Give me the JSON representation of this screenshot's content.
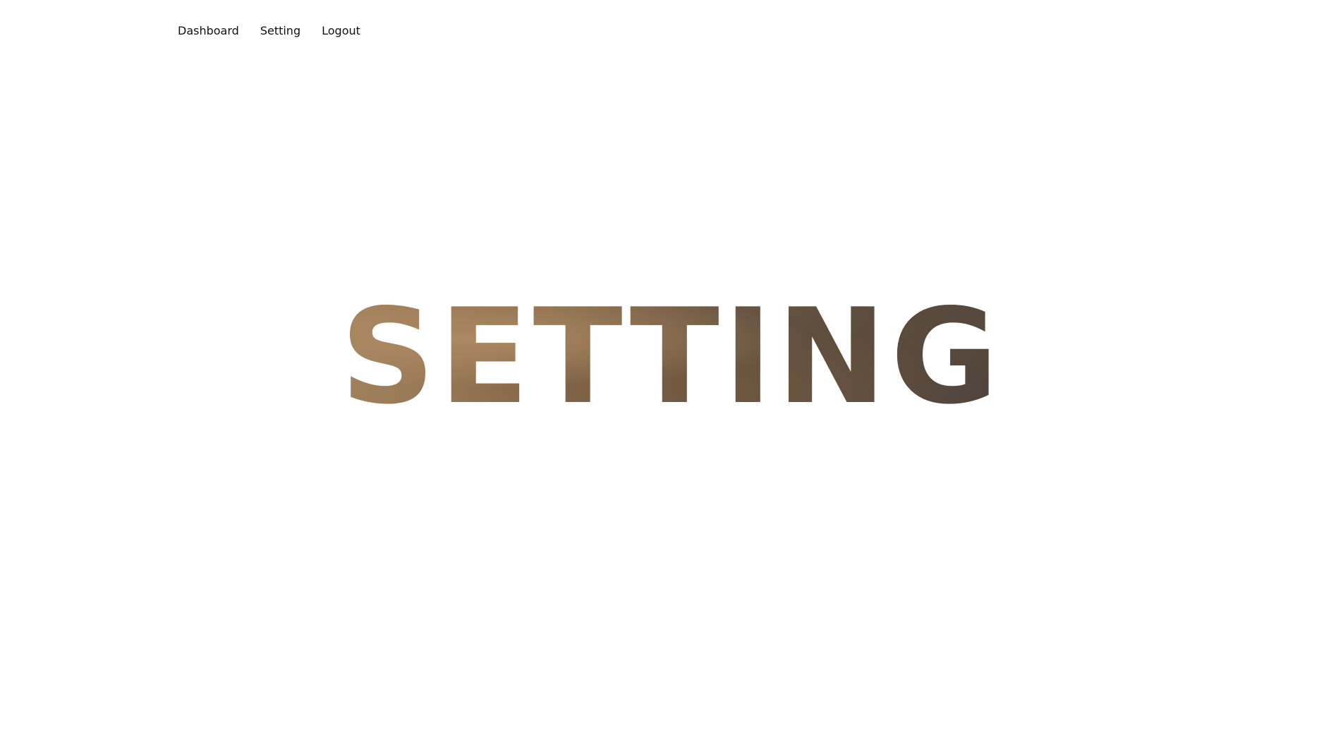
{
  "nav": {
    "items": [
      {
        "label": "Dashboard"
      },
      {
        "label": "Setting"
      },
      {
        "label": "Logout"
      }
    ]
  },
  "hero": {
    "title": "SETTING"
  }
}
